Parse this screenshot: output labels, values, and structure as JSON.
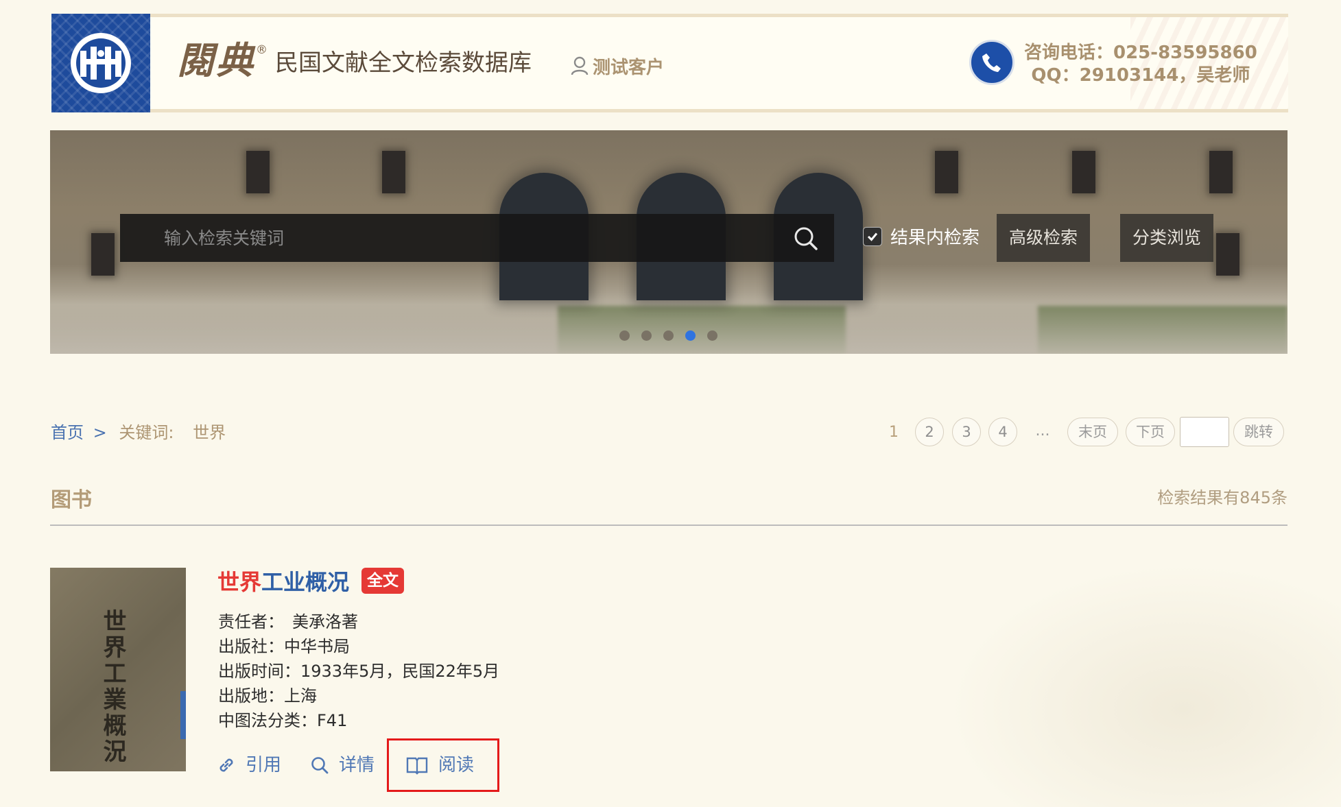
{
  "header": {
    "brand": "閱典",
    "brand_mark": "®",
    "site_title": "民国文献全文检索数据库",
    "user_name": "测试客户",
    "contact_phone": "咨询电话：025-83595860",
    "contact_qq": "QQ：29103144，吴老师"
  },
  "search": {
    "placeholder": "输入检索关键词",
    "within_results_label": "结果内检索",
    "within_results_checked": true,
    "advanced_label": "高级检索",
    "browse_label": "分类浏览"
  },
  "carousel": {
    "count": 5,
    "active_index": 3
  },
  "breadcrumb": {
    "home": "首页",
    "separator": ">",
    "keyword_label": "关键词:",
    "keyword_value": "世界"
  },
  "pagination": {
    "current": "1",
    "pages": [
      "2",
      "3",
      "4"
    ],
    "ellipsis": "...",
    "last_label": "末页",
    "next_label": "下页",
    "jump_label": "跳转"
  },
  "section": {
    "title": "图书",
    "result_count": "检索结果有845条"
  },
  "results": [
    {
      "title_highlight": "世界",
      "title_rest": "工业概况",
      "badge": "全文",
      "cover_text": "世界工業概況",
      "meta": [
        {
          "label": "责任者：",
          "value": "美承洛著"
        },
        {
          "label": "出版社：",
          "value": "中华书局"
        },
        {
          "label": "出版时间：",
          "value": "1933年5月，民国22年5月"
        },
        {
          "label": "出版地：",
          "value": "上海"
        },
        {
          "label": "中图法分类：",
          "value": "F41"
        }
      ],
      "actions": {
        "cite": "引用",
        "detail": "详情",
        "read": "阅读"
      }
    }
  ],
  "colors": {
    "page_bg": "#fbf8ec",
    "logo_blue": "#1e4b9c",
    "brand_brown": "#7b6147",
    "link_blue": "#2f5fa6",
    "highlight_red": "#e53935",
    "annotation_red": "#e41a1a",
    "carousel_active": "#2f73e0"
  }
}
